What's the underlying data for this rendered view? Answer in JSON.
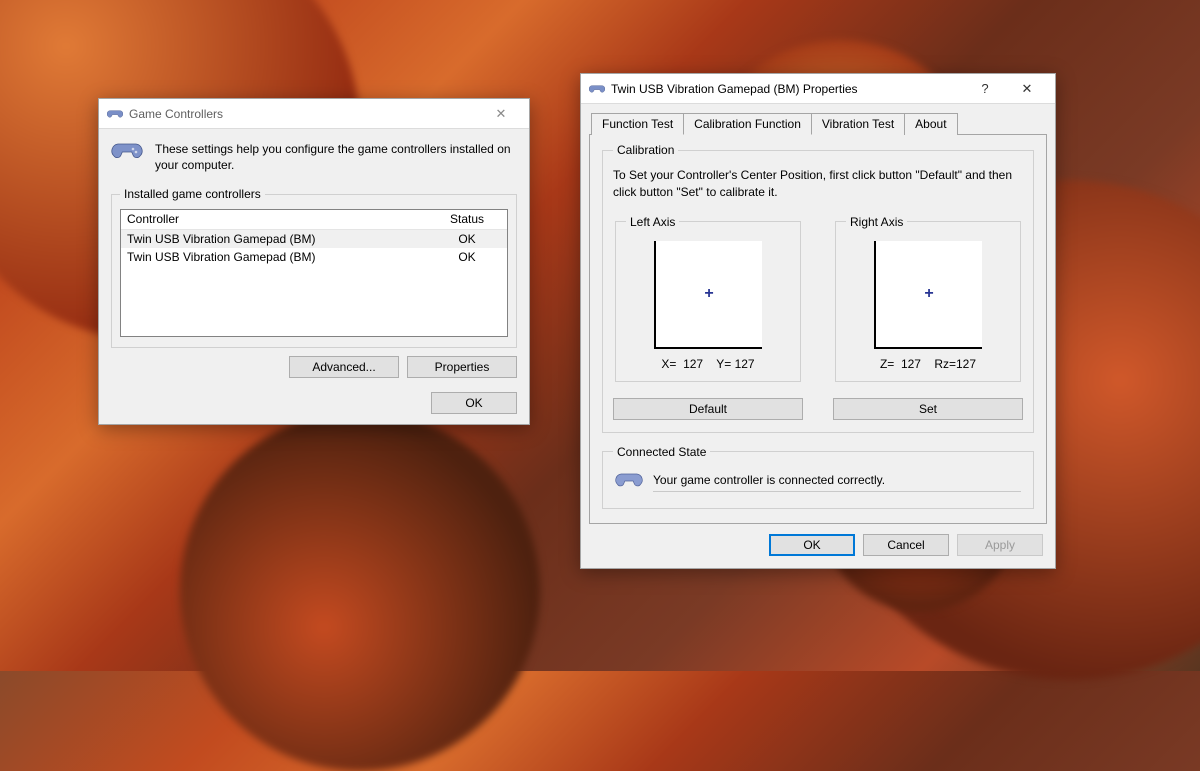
{
  "gc": {
    "title": "Game Controllers",
    "intro": "These settings help you configure the game controllers installed on your computer.",
    "group_label": "Installed game controllers",
    "col_controller": "Controller",
    "col_status": "Status",
    "rows": [
      {
        "name": "Twin USB Vibration Gamepad (BM)",
        "status": "OK"
      },
      {
        "name": "Twin USB Vibration Gamepad (BM)",
        "status": "OK"
      }
    ],
    "btn_advanced": "Advanced...",
    "btn_properties": "Properties",
    "btn_ok": "OK"
  },
  "prop": {
    "title": "Twin USB Vibration Gamepad (BM) Properties",
    "help": "?",
    "close": "✕",
    "tabs": {
      "function_test": "Function Test",
      "calibration": "Calibration Function",
      "vibration": "Vibration Test",
      "about": "About"
    },
    "calib": {
      "group_label": "Calibration",
      "instruction": "To Set your Controller's  Center Position, first click button \"Default\" and then click button \"Set\" to calibrate it.",
      "left_label": "Left Axis",
      "right_label": "Right Axis",
      "left_x": "X=  127",
      "left_y": "Y= 127",
      "right_z": "Z=  127",
      "right_rz": "Rz=127",
      "btn_default": "Default",
      "btn_set": "Set"
    },
    "conn": {
      "group_label": "Connected State",
      "text": "Your game controller is connected correctly."
    },
    "buttons": {
      "ok": "OK",
      "cancel": "Cancel",
      "apply": "Apply"
    }
  }
}
